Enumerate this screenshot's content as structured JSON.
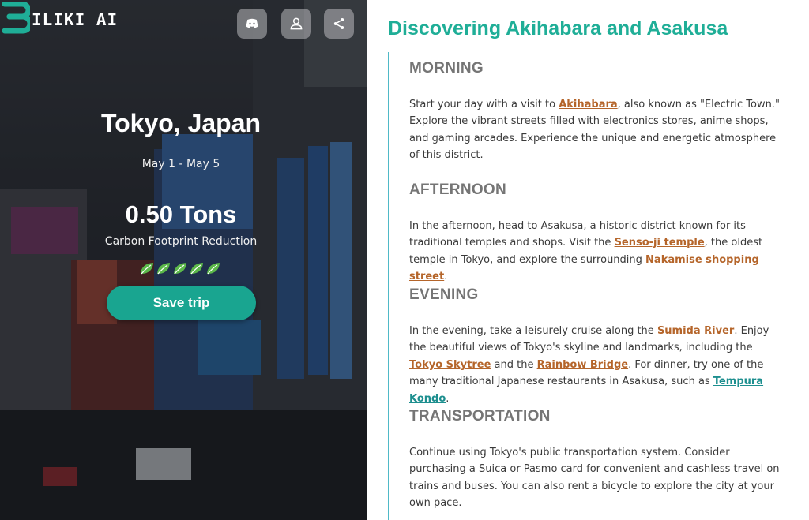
{
  "brand": {
    "name": "ILIKI AI"
  },
  "hero": {
    "title": "Tokyo, Japan",
    "dates": "May 1 - May 5",
    "carbon_value": "0.50 Tons",
    "carbon_label": "Carbon Footprint Reduction",
    "eco_rating": 5,
    "save_label": "Save trip"
  },
  "header_icons": [
    "discord-icon",
    "user-icon",
    "share-icon"
  ],
  "colors": {
    "accent": "#19a590",
    "title": "#1fae97",
    "link": "#b5652a",
    "link_alt": "#1d8f8f",
    "leaf": "#5cb84a"
  },
  "itinerary": {
    "title": "Discovering Akihabara and Asakusa",
    "sections": [
      {
        "heading": "MORNING",
        "parts": [
          {
            "t": "Start your day with a visit to "
          },
          {
            "t": "Akihabara",
            "link": true
          },
          {
            "t": ", also known as \"Electric Town.\" Explore the vibrant streets filled with electronics stores, anime shops, and gaming arcades. Experience the unique and energetic atmosphere of this district."
          }
        ]
      },
      {
        "heading": "AFTERNOON",
        "parts": [
          {
            "t": "In the afternoon, head to Asakusa, a historic district known for its traditional temples and shops. Visit the "
          },
          {
            "t": "Senso-ji temple",
            "link": true
          },
          {
            "t": ", the oldest temple in Tokyo, and explore the surrounding "
          },
          {
            "t": "Nakamise shopping street",
            "link": true
          },
          {
            "t": "."
          }
        ]
      },
      {
        "heading": "EVENING",
        "parts": [
          {
            "t": "In the evening, take a leisurely cruise along the "
          },
          {
            "t": "Sumida River",
            "link": true
          },
          {
            "t": ". Enjoy the beautiful views of Tokyo's skyline and landmarks, including the "
          },
          {
            "t": "Tokyo Skytree",
            "link": true
          },
          {
            "t": " and the "
          },
          {
            "t": "Rainbow Bridge",
            "link": true
          },
          {
            "t": ". For dinner, try one of the many traditional Japanese restaurants in Asakusa, such as "
          },
          {
            "t": "Tempura Kondo",
            "link": true,
            "alt": true
          },
          {
            "t": "."
          }
        ]
      },
      {
        "heading": "TRANSPORTATION",
        "parts": [
          {
            "t": "Continue using Tokyo's public transportation system. Consider purchasing a Suica or Pasmo card for convenient and cashless travel on trains and buses. You can also rent a bicycle to explore the city at your own pace."
          }
        ]
      }
    ]
  }
}
